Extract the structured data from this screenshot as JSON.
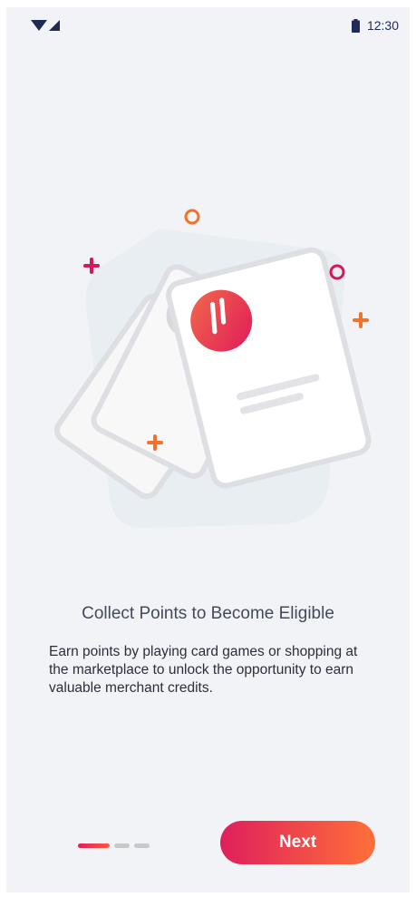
{
  "status_bar": {
    "time": "12:30",
    "icons": [
      "wifi-icon",
      "signal-icon",
      "battery-icon"
    ]
  },
  "onboarding": {
    "title": "Collect Points to Become Eligible",
    "description": "Earn points by playing card games or shopping at the marketplace to unlock the opportunity to earn valuable merchant credits.",
    "page_indicator": {
      "total": 3,
      "current": 1
    },
    "next_label": "Next"
  },
  "colors": {
    "background": "#f2f3f7",
    "accent_start": "#df1f5d",
    "accent_end": "#ff7038",
    "plus_pink": "#d6185a",
    "plus_orange": "#f3712a",
    "card_outline": "#dedfe3"
  }
}
